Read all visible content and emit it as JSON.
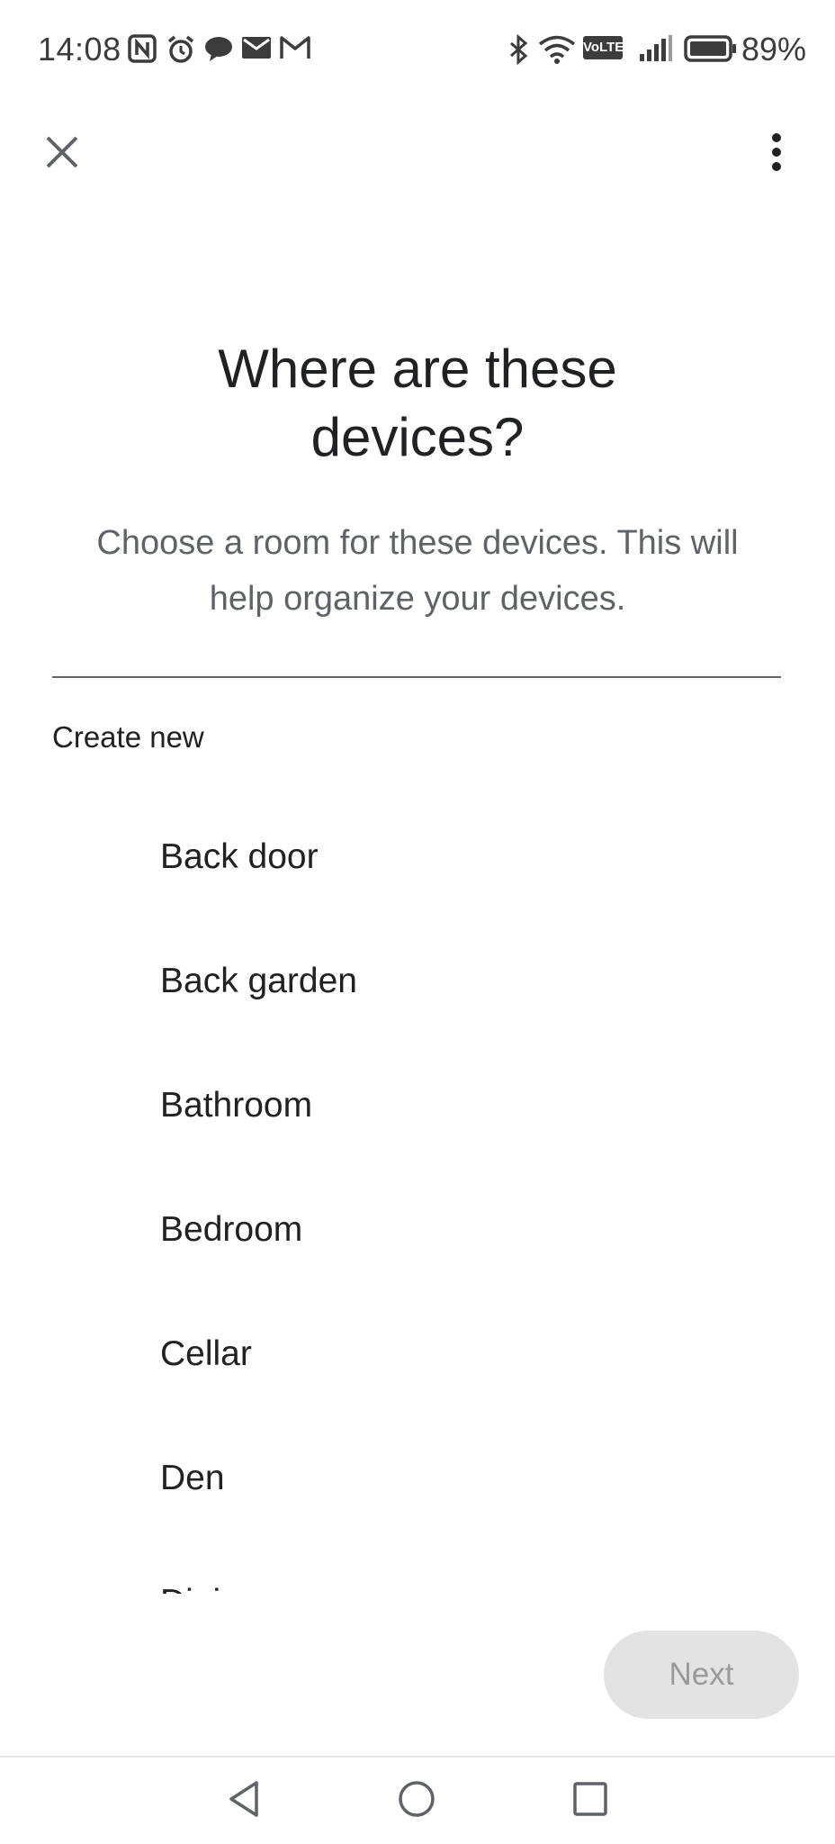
{
  "status_bar": {
    "time": "14:08",
    "battery_percent": "89%",
    "volte_label": "VoLTE",
    "notification_icons": [
      "nfc-icon",
      "alarm-icon",
      "chat-icon",
      "email-icon",
      "gmail-icon"
    ],
    "system_icons": [
      "bluetooth-icon",
      "wifi-icon",
      "volte-icon",
      "signal-icon",
      "battery-icon"
    ]
  },
  "app_bar": {
    "close_icon": "close-icon",
    "more_icon": "more-vert-icon"
  },
  "header": {
    "title_line1": "Where are these",
    "title_line2": "devices?",
    "subtitle_line1": "Choose a room for these devices. This will",
    "subtitle_line2": "help organize your devices."
  },
  "list": {
    "create_new_label": "Create new",
    "rooms": [
      {
        "label": "Back door"
      },
      {
        "label": "Back garden"
      },
      {
        "label": "Bathroom"
      },
      {
        "label": "Bedroom"
      },
      {
        "label": "Cellar"
      },
      {
        "label": "Den"
      },
      {
        "label": "Dining room"
      }
    ]
  },
  "footer": {
    "next_label": "Next",
    "next_enabled": false
  },
  "nav_bar": {
    "buttons": [
      "back-icon",
      "home-icon",
      "recents-icon"
    ]
  },
  "colors": {
    "text_primary": "#202124",
    "text_secondary": "#5f6368",
    "button_disabled_bg": "#e3e3e3",
    "button_disabled_text": "#9a9a9a"
  }
}
